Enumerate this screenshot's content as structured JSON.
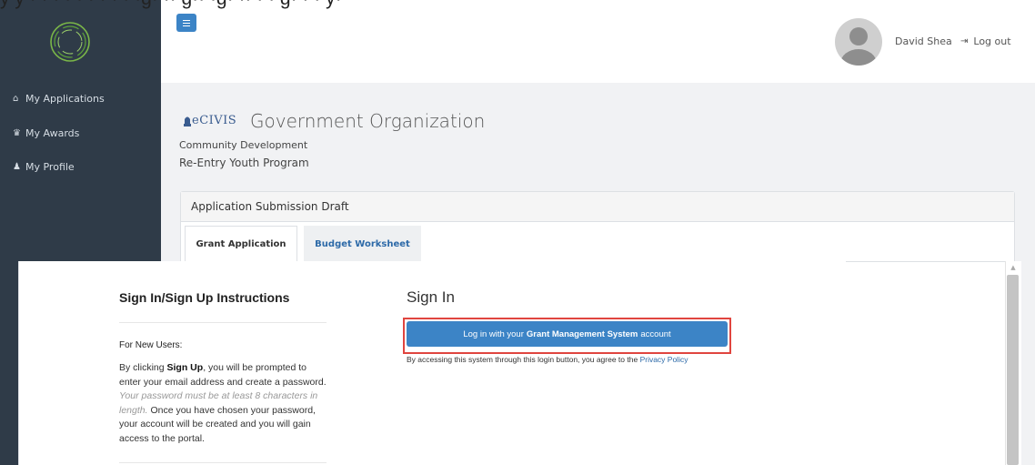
{
  "cutoff_text": "y y · · · · · · · · · ·g· ·· g·· ·g· ·· · · g· · · y·",
  "sidebar": {
    "logo": "ecivis-ring-logo",
    "items": [
      {
        "icon": "home-icon",
        "label": "My Applications"
      },
      {
        "icon": "trophy-icon",
        "label": "My Awards"
      },
      {
        "icon": "user-icon",
        "label": "My Profile"
      }
    ]
  },
  "header": {
    "menu_icon": "hamburger-icon",
    "user_name": "David Shea",
    "logout_label": "Log out"
  },
  "main": {
    "brand": "eCIVIS",
    "organization": "Government Organization",
    "department": "Community Development",
    "program": "Re-Entry Youth Program",
    "panel_title": "Application Submission Draft",
    "tabs": [
      {
        "label": "Grant Application",
        "active": true
      },
      {
        "label": "Budget Worksheet",
        "active": false
      }
    ]
  },
  "instructions": {
    "title": "Sign In/Sign Up Instructions",
    "subheading": "For New Users:",
    "p1": "By clicking ",
    "p1_bold": "Sign Up",
    "p2": ", you will be prompted to enter your email address and create a password. ",
    "p2_italic": "Your password must be at least 8 characters in length.",
    "p3": " Once you have chosen your password, your account will be created and you will gain access to the portal."
  },
  "signin": {
    "title": "Sign In",
    "button_pre": "Log in with your",
    "button_bold": "Grant Management System",
    "button_post": "account",
    "notice_text": "By accessing this system through this login button, you agree to the ",
    "notice_link": "Privacy Policy"
  },
  "colors": {
    "sidebar_bg": "#2f3b48",
    "accent_blue": "#3c84c6",
    "highlight_red": "#e0453f"
  }
}
